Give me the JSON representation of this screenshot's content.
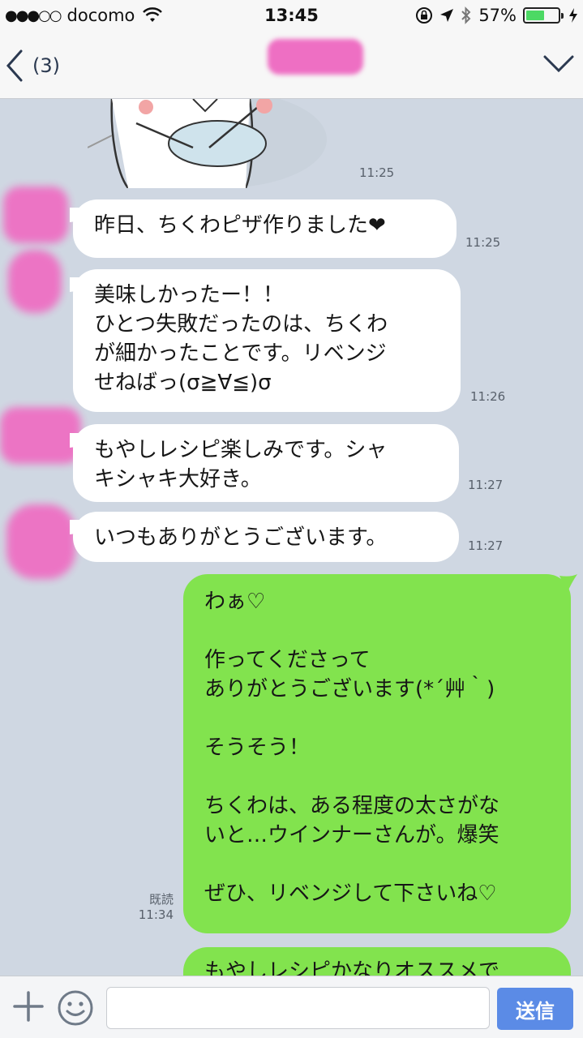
{
  "status_bar": {
    "carrier": "docomo",
    "time": "13:45",
    "battery_percent": "57%",
    "battery_level": 0.57,
    "icons": [
      "signal-dots-icon",
      "wifi-icon",
      "orientation-lock-icon",
      "location-arrow-icon",
      "bluetooth-icon",
      "battery-icon",
      "charging-bolt-icon"
    ]
  },
  "nav": {
    "back_count": "(3)",
    "icons": [
      "chevron-left-icon",
      "chevron-down-icon"
    ]
  },
  "messages": {
    "sticker_time": "11:25",
    "m1": {
      "text": "昨日、ちくわピザ作りました❤",
      "time": "11:25"
    },
    "m2": {
      "text": "美味しかったー！！\nひとつ失敗だったのは、ちくわ\nが細かったことです。リベンジ\nせねばっ(σ≧∀≦)σ",
      "time": "11:26"
    },
    "m3": {
      "text": "もやしレシピ楽しみです。シャ\nキシャキ大好き。",
      "time": "11:27"
    },
    "m4": {
      "text": "いつもありがとうございます。",
      "time": "11:27"
    },
    "m5": {
      "text": "わぁ♡\n\n作ってくださって\nありがとうございます(*´艸｀)\n\nそうそう！\n\nちくわは、ある程度の太さがな\nいと…ウインナーさんが。爆笑\n\nぜひ、リベンジして下さいね♡",
      "read_label": "既読",
      "time": "11:34"
    },
    "m6": {
      "text": "もやしレシピかなりオススメで"
    }
  },
  "input_bar": {
    "placeholder": "",
    "send_label": "送信",
    "icons": [
      "plus-icon",
      "emoji-icon"
    ]
  },
  "colors": {
    "chat_background": "#cfd7e2",
    "incoming_bubble": "#ffffff",
    "outgoing_bubble": "#82e34e",
    "send_button": "#5b8be6",
    "redaction": "#ee6fc3"
  }
}
